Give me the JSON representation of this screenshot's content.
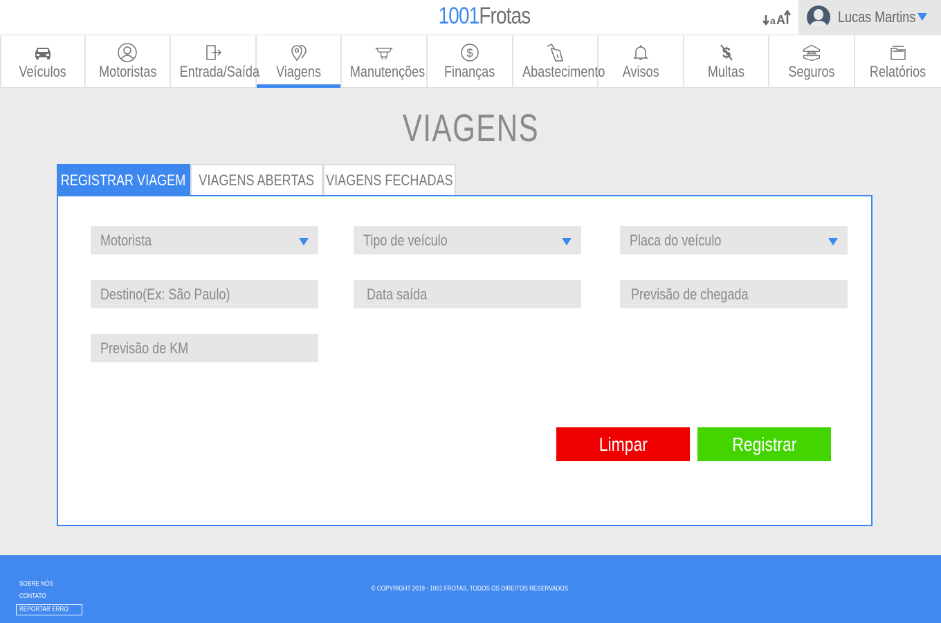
{
  "brand": {
    "number": "1001",
    "name": "Frotas",
    "accent_color": "#3d88ee"
  },
  "header": {
    "font_size_icon": "font-size-toggle-icon",
    "user_name": "Lucas Martins"
  },
  "nav": {
    "items": [
      {
        "label": "Veículos",
        "icon": "car-icon"
      },
      {
        "label": "Motoristas",
        "icon": "driver-icon"
      },
      {
        "label": "Entrada/Saída",
        "icon": "door-exit-icon"
      },
      {
        "label": "Viagens",
        "icon": "map-pin-icon",
        "active": true
      },
      {
        "label": "Manutenções",
        "icon": "wrench-icon"
      },
      {
        "label": "Finanças",
        "icon": "dollar-icon"
      },
      {
        "label": "Abastecimento",
        "icon": "fuel-pump-icon"
      },
      {
        "label": "Avisos",
        "icon": "bell-icon"
      },
      {
        "label": "Multas",
        "icon": "fine-icon"
      },
      {
        "label": "Seguros",
        "icon": "insurance-icon"
      },
      {
        "label": "Relatórios",
        "icon": "folder-icon"
      }
    ]
  },
  "page": {
    "title": "VIAGENS"
  },
  "tabs": [
    {
      "label": "REGISTRAR VIAGEM",
      "active": true
    },
    {
      "label": "VIAGENS ABERTAS",
      "active": false
    },
    {
      "label": "VIAGENS FECHADAS",
      "active": false
    }
  ],
  "form": {
    "motorista": "Motorista",
    "tipo_veiculo": "Tipo de veículo",
    "placa_veiculo": "Placa do veículo",
    "destino": "Destino(Ex: São Paulo)",
    "data_saida": "Data saída",
    "previsao_chegada": "Previsão de chegada",
    "previsao_km": "Previsão de KM",
    "clear_label": "Limpar",
    "submit_label": "Registrar",
    "clear_color": "#ee0000",
    "submit_color": "#44d400"
  },
  "footer": {
    "links": [
      "SOBRE NÓS",
      "CONTATO",
      "REPORTAR ERRO"
    ],
    "copyright": "© COPYRIGHT 2019 - 1001 FROTAS, TODOS OS DIREITOS RESERVADOS."
  }
}
